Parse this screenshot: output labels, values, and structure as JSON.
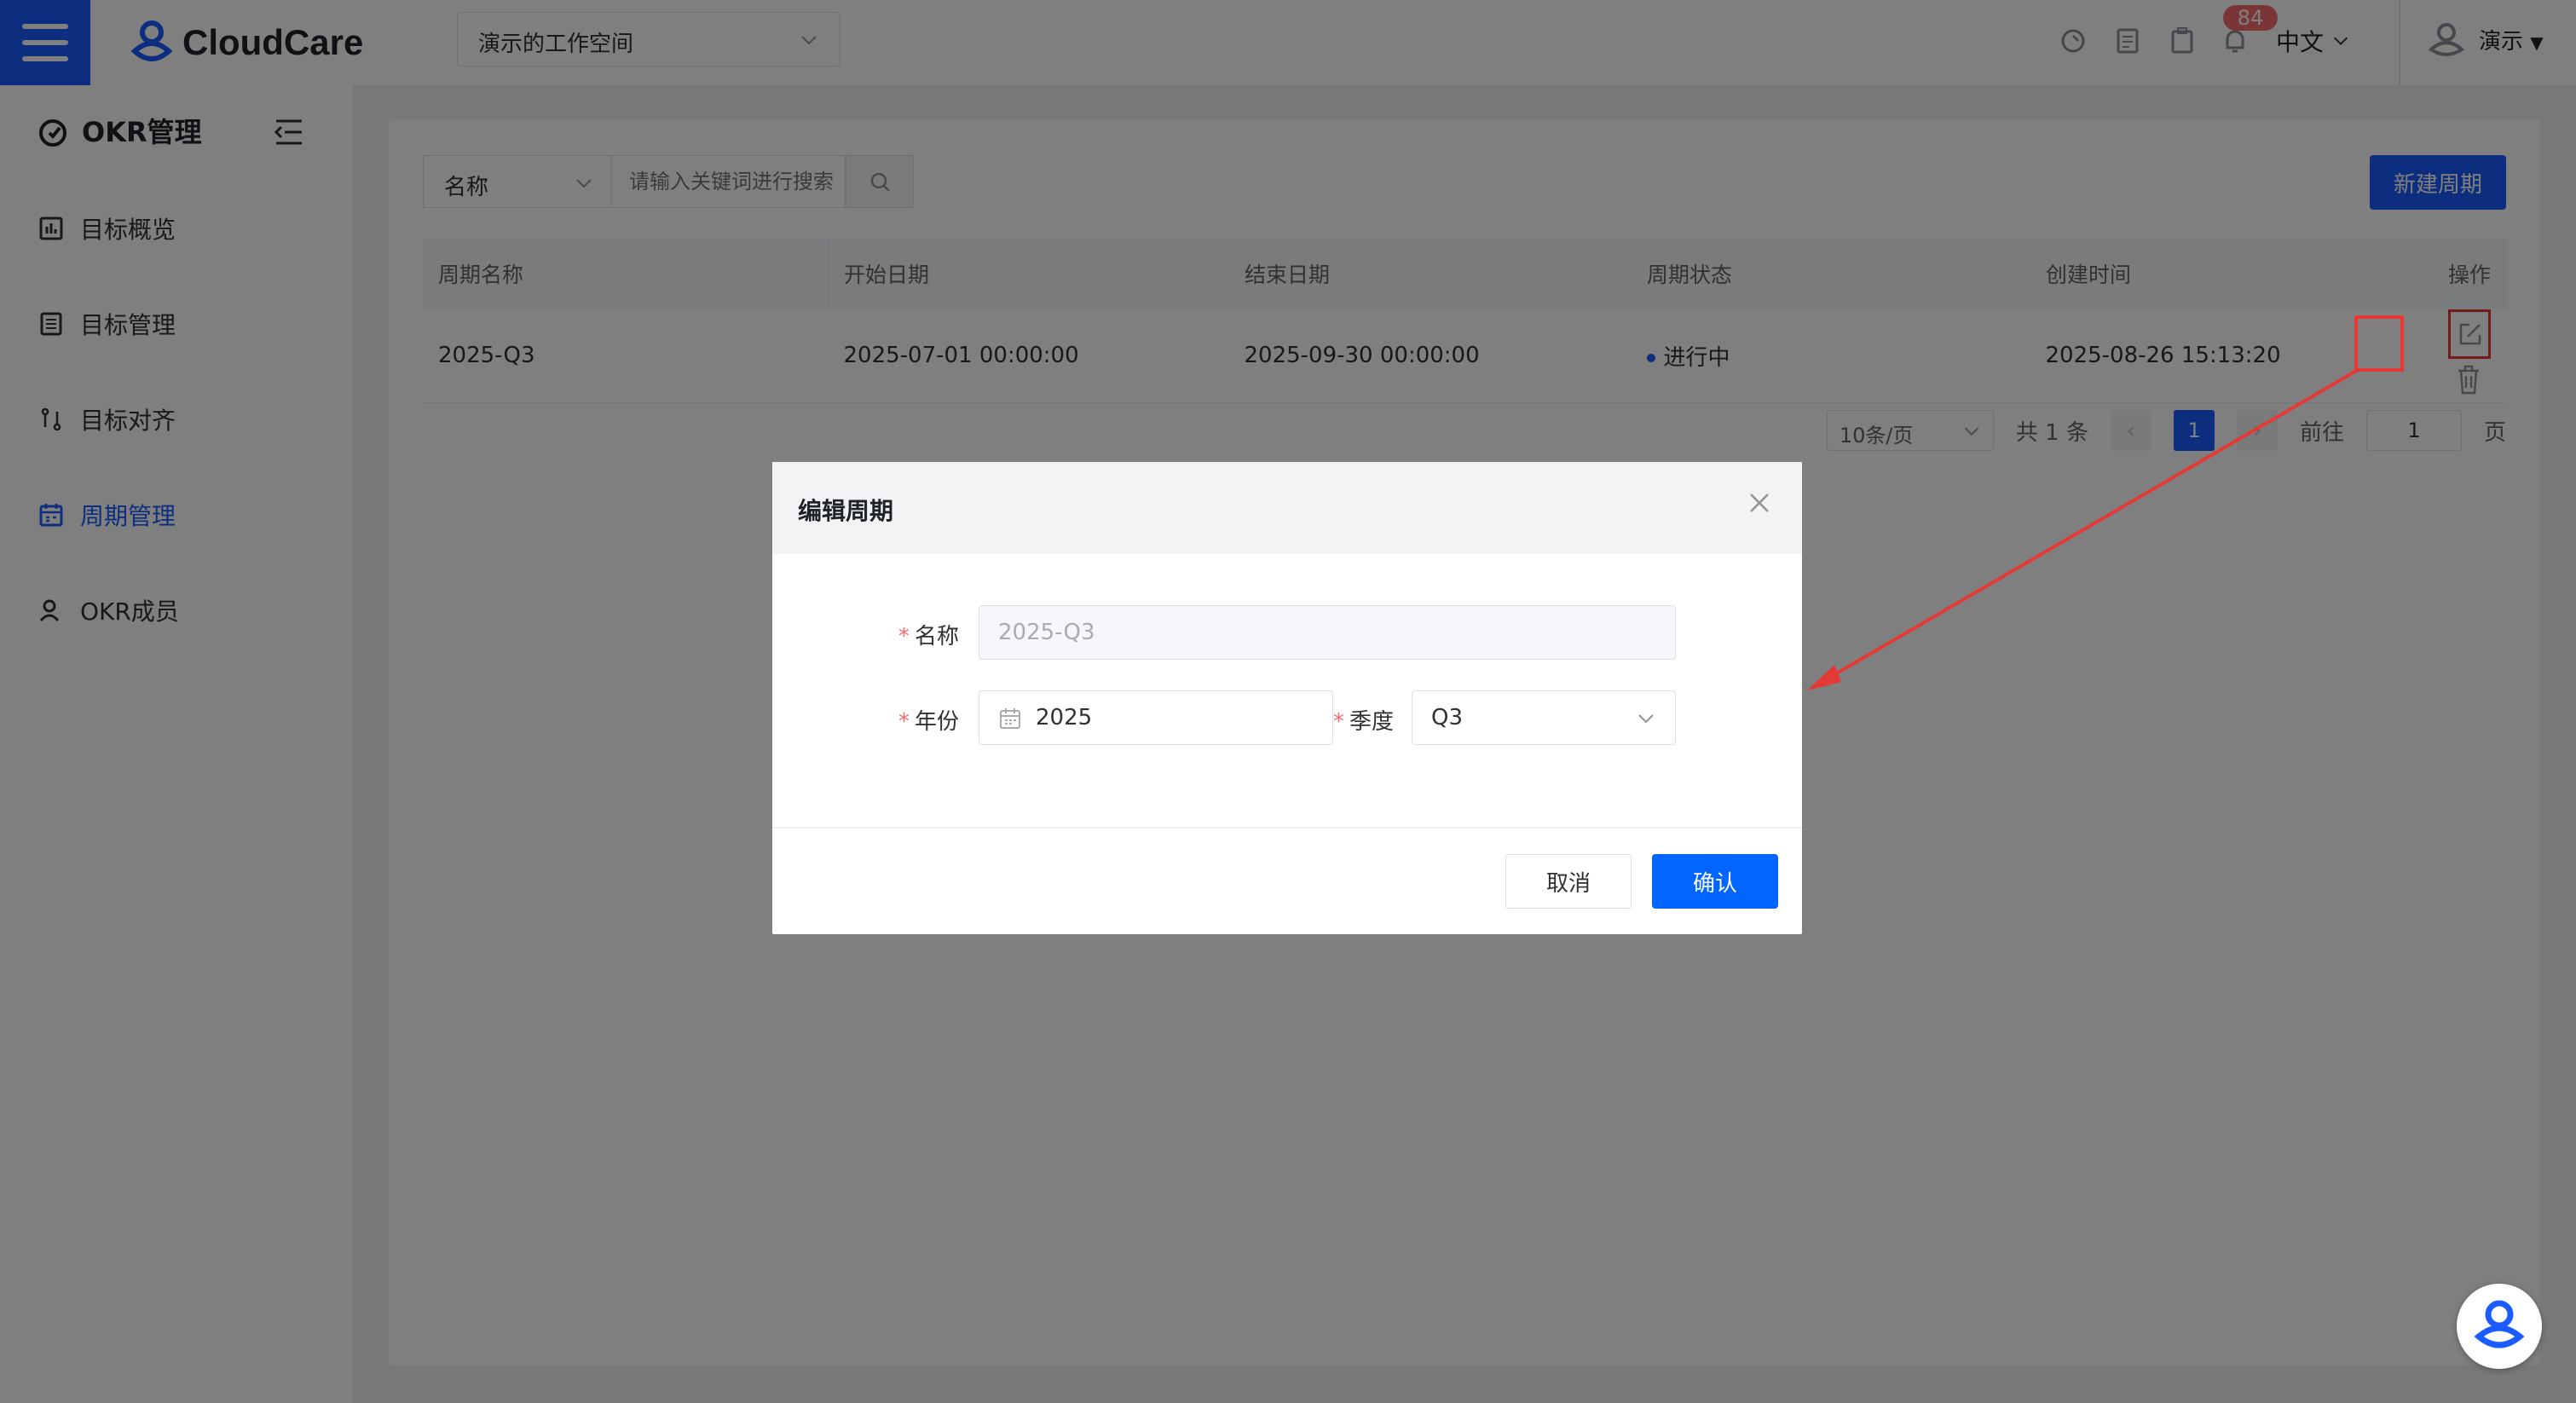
{
  "app": {
    "brand": "CloudCare",
    "workspace": "演示的工作空间",
    "notification_count": "84",
    "language": "中文",
    "user": "演示"
  },
  "sidebar": {
    "title": "OKR管理",
    "items": [
      {
        "label": "目标概览",
        "icon": "chart-icon"
      },
      {
        "label": "目标管理",
        "icon": "list-icon"
      },
      {
        "label": "目标对齐",
        "icon": "align-icon"
      },
      {
        "label": "周期管理",
        "icon": "calendar-icon",
        "active": true
      },
      {
        "label": "OKR成员",
        "icon": "member-icon"
      }
    ]
  },
  "toolbar": {
    "filter_field": "名称",
    "search_placeholder": "请输入关键词进行搜索",
    "new_button": "新建周期"
  },
  "table": {
    "headers": [
      "周期名称",
      "开始日期",
      "结束日期",
      "周期状态",
      "创建时间",
      "操作"
    ],
    "rows": [
      {
        "name": "2025-Q3",
        "start": "2025-07-01 00:00:00",
        "end": "2025-09-30 00:00:00",
        "status": "进行中",
        "created": "2025-08-26 15:13:20"
      }
    ]
  },
  "pagination": {
    "page_size": "10条/页",
    "total": "共 1 条",
    "current": "1",
    "goto_label": "前往",
    "goto_value": "1",
    "page_suffix": "页"
  },
  "dialog": {
    "title": "编辑周期",
    "name_label": "名称",
    "name_value": "2025-Q3",
    "year_label": "年份",
    "year_value": "2025",
    "quarter_label": "季度",
    "quarter_value": "Q3",
    "required_mark": "*",
    "cancel": "取消",
    "confirm": "确认"
  },
  "colors": {
    "primary": "#1a5cff",
    "annotation": "#e53935"
  }
}
